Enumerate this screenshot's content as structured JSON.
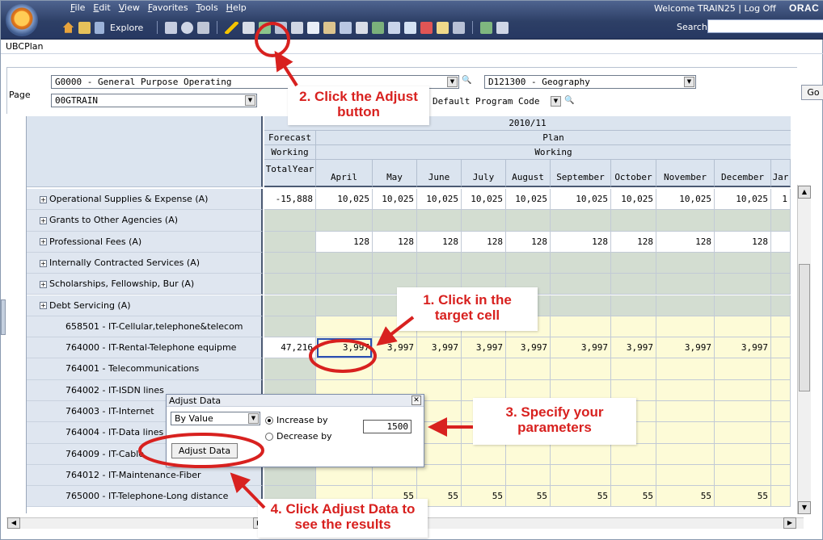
{
  "menu": [
    "File",
    "Edit",
    "View",
    "Favorites",
    "Tools",
    "Help"
  ],
  "welcome": {
    "text": "Welcome",
    "user": "TRAIN25",
    "sep": "|",
    "logoff": "Log Off",
    "brand": "ORAC"
  },
  "toolbar": {
    "explore_label": "Explore",
    "search_label": "Search",
    "search_value": ""
  },
  "app_name": "UBCPlan",
  "page": {
    "label": "Page",
    "fund": "G0000 - General Purpose Operating",
    "dept": "00GTRAIN",
    "geography": "D121300 - Geography",
    "program": "Default Program Code",
    "go_label": "Go"
  },
  "grid": {
    "year": "2010/11",
    "scenario_left": "Forecast",
    "scenario_right": "Plan",
    "version_left": "Working",
    "version_right": "Working",
    "columns": [
      "TotalYear",
      "April",
      "May",
      "June",
      "July",
      "August",
      "September",
      "October",
      "November",
      "December",
      "Jar"
    ],
    "rows": [
      {
        "label": "Operational Supplies & Expense (A)",
        "exp": true,
        "values": [
          "-15,888",
          "10,025",
          "10,025",
          "10,025",
          "10,025",
          "10,025",
          "10,025",
          "10,025",
          "10,025",
          "10,025",
          "1"
        ]
      },
      {
        "label": "Grants to Other Agencies (A)",
        "exp": true,
        "values": [
          "",
          "",
          "",
          "",
          "",
          "",
          "",
          "",
          "",
          "",
          ""
        ]
      },
      {
        "label": "Professional Fees (A)",
        "exp": true,
        "values": [
          "",
          "128",
          "128",
          "128",
          "128",
          "128",
          "128",
          "128",
          "128",
          "128",
          ""
        ]
      },
      {
        "label": "Internally Contracted Services (A)",
        "exp": true,
        "values": [
          "",
          "",
          "",
          "",
          "",
          "",
          "",
          "",
          "",
          "",
          ""
        ]
      },
      {
        "label": "Scholarships, Fellowship, Bur (A)",
        "exp": true,
        "values": [
          "",
          "",
          "",
          "",
          "",
          "",
          "",
          "",
          "",
          "",
          ""
        ]
      },
      {
        "label": "Debt Servicing (A)",
        "exp": true,
        "values": [
          "",
          "",
          "",
          "",
          "",
          "",
          "",
          "",
          "",
          "",
          ""
        ]
      },
      {
        "label": "658501 - IT-Cellular,telephone&telecom",
        "exp": false,
        "values": [
          "",
          "",
          "",
          "",
          "",
          "",
          "",
          "",
          "",
          "",
          ""
        ]
      },
      {
        "label": "764000 - IT-Rental-Telephone equipme",
        "exp": false,
        "values": [
          "47,216",
          "3,997",
          "3,997",
          "3,997",
          "3,997",
          "3,997",
          "3,997",
          "3,997",
          "3,997",
          "3,997",
          ""
        ]
      },
      {
        "label": "764001 - Telecommunications",
        "exp": false,
        "values": [
          "",
          "",
          "",
          "",
          "",
          "",
          "",
          "",
          "",
          "",
          ""
        ]
      },
      {
        "label": "764002 - IT-ISDN lines",
        "exp": false,
        "values": [
          "",
          "",
          "",
          "",
          "",
          "",
          "",
          "",
          "",
          "",
          ""
        ]
      },
      {
        "label": "764003 - IT-Internet",
        "exp": false,
        "values": [
          "",
          "",
          "",
          "",
          "",
          "",
          "",
          "",
          "",
          "",
          ""
        ]
      },
      {
        "label": "764004 - IT-Data lines",
        "exp": false,
        "values": [
          "",
          "",
          "",
          "",
          "",
          "",
          "",
          "",
          "",
          "",
          ""
        ]
      },
      {
        "label": "764009 - IT-Cable",
        "exp": false,
        "values": [
          "",
          "",
          "",
          "",
          "",
          "",
          "",
          "",
          "",
          "",
          ""
        ]
      },
      {
        "label": "764012 - IT-Maintenance-Fiber",
        "exp": false,
        "values": [
          "",
          "",
          "",
          "",
          "",
          "",
          "",
          "",
          "",
          "",
          ""
        ]
      },
      {
        "label": "765000 - IT-Telephone-Long distance",
        "exp": false,
        "values": [
          "",
          "",
          "55",
          "55",
          "55",
          "55",
          "55",
          "55",
          "55",
          "55",
          ""
        ]
      }
    ]
  },
  "adjust_dialog": {
    "title": "Adjust Data",
    "mode": "By Value",
    "increase_label": "Increase by",
    "decrease_label": "Decrease by",
    "increase_selected": true,
    "amount": "1500",
    "button_label": "Adjust Data"
  },
  "callouts": {
    "step1": "1.  Click in the target cell",
    "step2": "2.  Click the Adjust button",
    "step3": "3.  Specify your parameters",
    "step4": "4.  Click Adjust Data to see the results"
  },
  "colors": {
    "accent_red": "#d8211f",
    "header_bg": "#dbe4ef",
    "edit_bg": "#fdfbd7",
    "locked_bg": "#d3ddd1",
    "label_bg": "#dfe6f0"
  }
}
